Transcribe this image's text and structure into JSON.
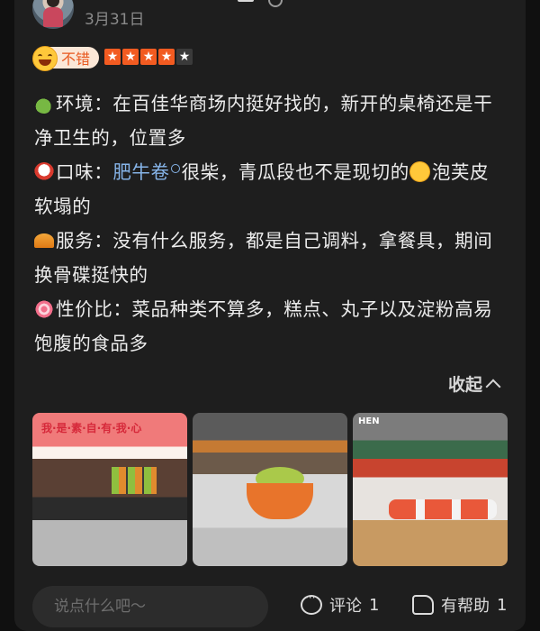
{
  "review": {
    "date": "3月31日",
    "rating_label": "不错",
    "stars": 4,
    "stars_max": 5,
    "star_glyph": "★",
    "lines": {
      "env_label": "环境",
      "env_text": "：在百佳华商场内挺好找的，新开的桌椅还是干净卫生的，位置多",
      "taste_label": "口味",
      "taste_pre": "：",
      "taste_link": "肥牛卷",
      "taste_text": "很柴，青瓜段也不是现切的",
      "taste_text2": "泡芙皮软塌的",
      "service_label": "服务",
      "service_text": "：没有什么服务，都是自己调料，拿餐具，期间换骨碟挺快的",
      "value_label": "性价比",
      "value_text": "：菜品种类不算多，糕点、丸子以及淀粉高易饱腹的食品多"
    },
    "collapse_label": "收起"
  },
  "photos": {
    "sign1": "我·是·素·自·有·我·心",
    "sign3": "HEN"
  },
  "footer": {
    "comment_placeholder": "说点什么吧～",
    "comment_label": "评论",
    "comment_count": "1",
    "helpful_label": "有帮助",
    "helpful_count": "1"
  },
  "colors": {
    "accent": "#f25b21",
    "link": "#86b4e8",
    "background": "#1e1e1e"
  }
}
